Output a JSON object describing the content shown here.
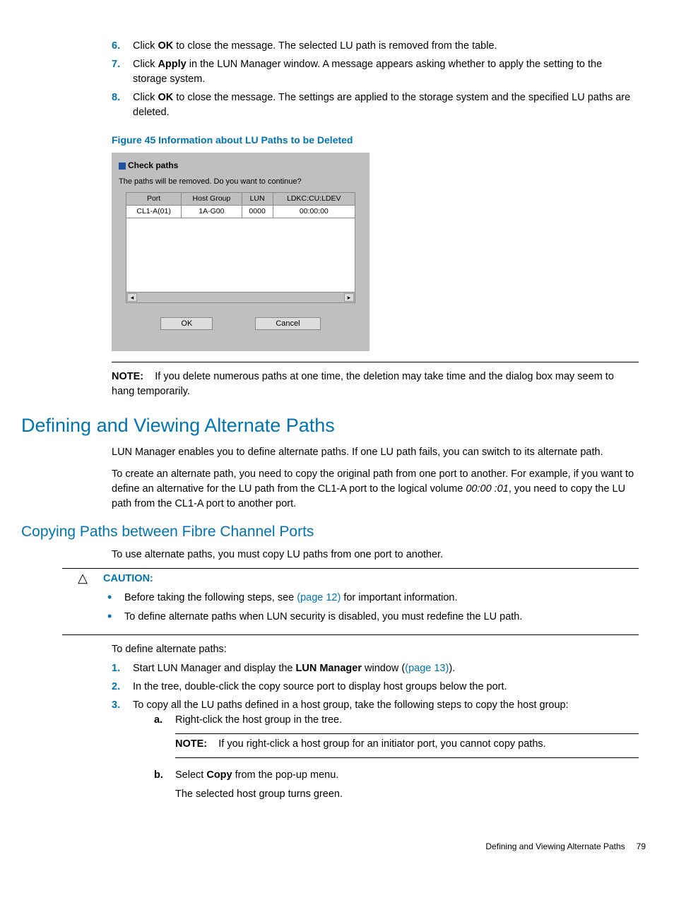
{
  "steps_top": [
    {
      "num": "6.",
      "pre": "Click ",
      "bold": "OK",
      "post": " to close the message. The selected LU path is removed from the table."
    },
    {
      "num": "7.",
      "pre": "Click ",
      "bold": "Apply",
      "post": " in the LUN Manager window. A message appears asking whether to apply the setting to the storage system."
    },
    {
      "num": "8.",
      "pre": "Click ",
      "bold": "OK",
      "post": " to close the message. The settings are applied to the storage system and the specified LU paths are deleted."
    }
  ],
  "figure_caption": "Figure 45 Information about LU Paths to be Deleted",
  "dialog": {
    "title": "Check paths",
    "message": "The paths will be removed. Do you want to continue?",
    "headers": [
      "Port",
      "Host Group",
      "LUN",
      "LDKC:CU:LDEV"
    ],
    "row": [
      "CL1-A(01)",
      "1A-G00",
      "0000",
      "00:00:00"
    ],
    "ok": "OK",
    "cancel": "Cancel"
  },
  "note1": {
    "label": "NOTE:",
    "text": "If you delete numerous paths at one time, the deletion may take time and the dialog box may seem to hang temporarily."
  },
  "h1": "Defining and Viewing Alternate Paths",
  "p1": "LUN Manager enables you to define alternate paths. If one LU path fails, you can switch to its alternate path.",
  "p2_pre": "To create an alternate path, you need to copy the original path from one port to another. For example, if you want to define an alternative for the LU path from the CL1-A port to the logical volume ",
  "p2_italic": "00:00 :01",
  "p2_post": ", you need to copy the LU path from the CL1-A port to another port.",
  "h2": "Copying Paths between Fibre Channel Ports",
  "p3": "To use alternate paths, you must copy LU paths from one port to another.",
  "caution": {
    "label": "CAUTION:",
    "b1_pre": "Before taking the following steps, see ",
    "b1_link": "(page 12)",
    "b1_post": " for important information.",
    "b2": "To define alternate paths when LUN security is disabled, you must redefine the LU path."
  },
  "p4": "To define alternate paths:",
  "steps_bottom": {
    "s1_pre": "Start LUN Manager and display the ",
    "s1_bold": "LUN Manager",
    "s1_mid": " window (",
    "s1_link": "(page 13)",
    "s1_post": ").",
    "s2": "In the tree, double-click the copy source port to display host groups below the port.",
    "s3": "To copy all the LU paths defined in a host group, take the following steps to copy the host group:",
    "s3a": "Right-click the host group in the tree.",
    "s3note_label": "NOTE:",
    "s3note_text": "If you right-click a host group for an initiator port, you cannot copy paths.",
    "s3b_pre": "Select ",
    "s3b_bold": "Copy",
    "s3b_post": " from the pop-up menu.",
    "s3b_after": "The selected host group turns green."
  },
  "footer": {
    "title": "Defining and Viewing Alternate Paths",
    "page": "79"
  }
}
